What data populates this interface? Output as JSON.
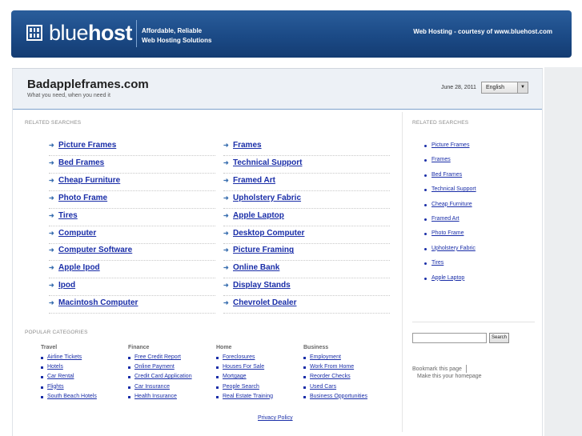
{
  "banner": {
    "logo_regular": "blue",
    "logo_bold": "host",
    "tagline_line1": "Affordable, Reliable",
    "tagline_line2": "Web Hosting Solutions",
    "courtesy": "Web Hosting - courtesy of www.bluehost.com"
  },
  "site": {
    "title": "Badappleframes.com",
    "subtitle": "What you need, when you need it",
    "date": "June 28, 2011",
    "language": "English"
  },
  "related_label": "RELATED SEARCHES",
  "related_left": [
    "Picture Frames",
    "Bed Frames",
    "Cheap Furniture",
    "Photo Frame",
    "Tires",
    "Computer",
    "Computer Software",
    "Apple Ipod",
    "Ipod",
    "Macintosh Computer"
  ],
  "related_right": [
    "Frames",
    "Technical Support",
    "Framed Art",
    "Upholstery Fabric",
    "Apple Laptop",
    "Desktop Computer",
    "Picture Framing",
    "Online Bank",
    "Display Stands",
    "Chevrolet Dealer"
  ],
  "sidebar": {
    "label": "RELATED SEARCHES",
    "items": [
      "Picture Frames",
      "Frames",
      "Bed Frames",
      "Technical Support",
      "Cheap Furniture",
      "Framed Art",
      "Photo Frame",
      "Upholstery Fabric",
      "Tires",
      "Apple Laptop"
    ],
    "search_button": "Search",
    "bookmark": "Bookmark this page",
    "homepage": "Make this your homepage"
  },
  "popular": {
    "label": "POPULAR CATEGORIES",
    "columns": [
      {
        "title": "Travel",
        "items": [
          "Airline Tickets",
          "Hotels",
          "Car Rental",
          "Flights",
          "South Beach Hotels"
        ]
      },
      {
        "title": "Finance",
        "items": [
          "Free Credit Report",
          "Online Payment",
          "Credit Card Application",
          "Car Insurance",
          "Health Insurance"
        ]
      },
      {
        "title": "Home",
        "items": [
          "Foreclosures",
          "Houses For Sale",
          "Mortgage",
          "People Search",
          "Real Estate Training"
        ]
      },
      {
        "title": "Business",
        "items": [
          "Employment",
          "Work From Home",
          "Reorder Checks",
          "Used Cars",
          "Business Opportunities"
        ]
      }
    ]
  },
  "footer": {
    "privacy": "Privacy Policy"
  },
  "colors": {
    "link": "#1a2ea8",
    "banner": "#1b4a86"
  }
}
